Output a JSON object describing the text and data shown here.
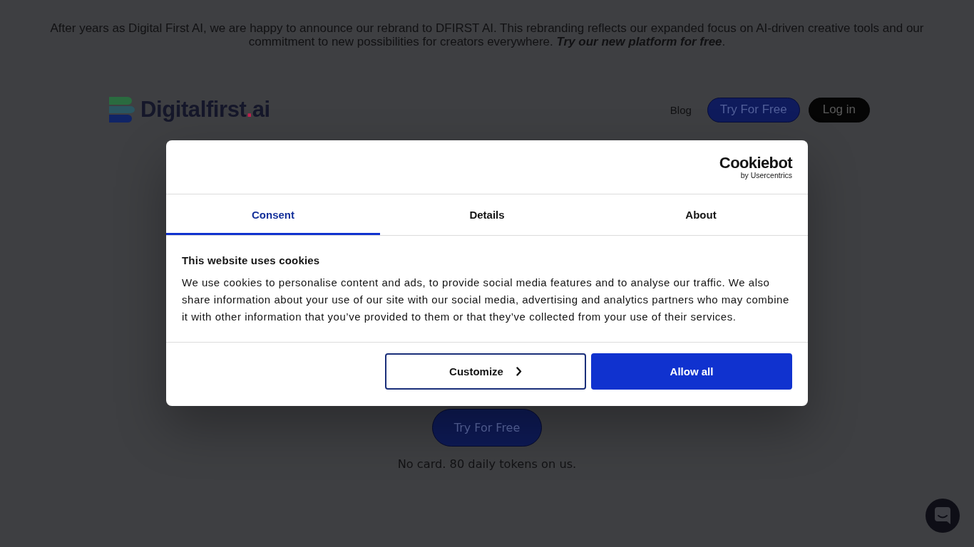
{
  "announcement": {
    "text": "After years as Digital First AI, we are happy to announce our rebrand to DFIRST AI. This rebranding reflects our expanded focus on AI-driven creative tools and our commitment to new possibilities for creators everywhere.",
    "link": "Try our new platform for free",
    "text_end": "."
  },
  "header": {
    "logo": {
      "name": "Digitalfirst",
      "dot": ".",
      "suffix": "ai"
    },
    "nav": [
      {
        "label": "Blog",
        "kind": "link"
      },
      {
        "label": "Try For Free",
        "kind": "primary"
      },
      {
        "label": "Log in",
        "kind": "dark"
      }
    ]
  },
  "hero": {
    "cta": "Try For Free",
    "note": "No card. 80 daily tokens on us."
  },
  "cookie_dialog": {
    "provider": {
      "name": "Cookiebot",
      "byline": "by Usercentrics"
    },
    "tabs": [
      {
        "label": "Consent",
        "selected": true
      },
      {
        "label": "Details",
        "selected": false
      },
      {
        "label": "About",
        "selected": false
      }
    ],
    "title": "This website uses cookies",
    "body": "We use cookies to personalise content and ads, to provide social media features and to analyse our traffic. We also share information about your use of our site with our social media, advertising and analytics partners who may combine it with other information that you’ve provided to them or that they’ve collected from your use of their services.",
    "buttons": [
      {
        "label": "Customize",
        "kind": "outline"
      },
      {
        "label": "Allow all",
        "kind": "primary"
      }
    ]
  }
}
